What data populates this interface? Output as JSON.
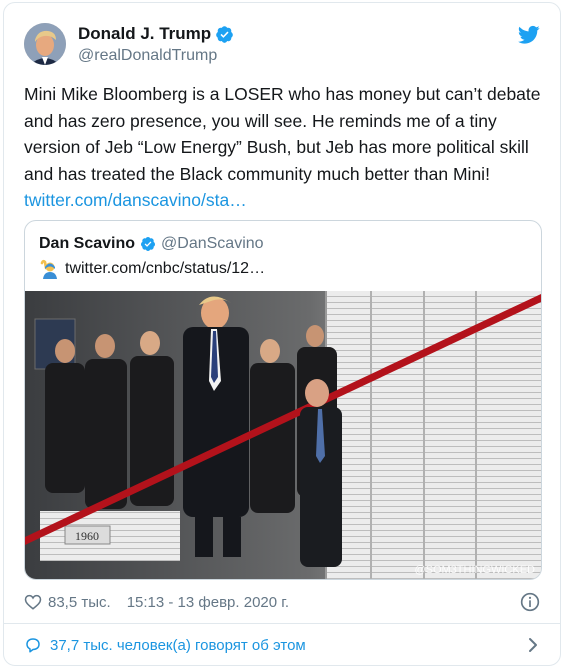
{
  "author": {
    "display_name": "Donald J. Trump",
    "handle": "@realDonaldTrump",
    "verified": true
  },
  "tweet": {
    "text": "Mini Mike Bloomberg is a LOSER who has money but can’t debate and has zero presence, you will see. He reminds me of a tiny version of Jeb “Low Energy” Bush, but Jeb has more political skill and has treated the Black community much better than Mini!",
    "link": "twitter.com/danscavino/sta…"
  },
  "quoted_tweet": {
    "display_name": "Dan Scavino",
    "handle": "@DanScavino",
    "verified": true,
    "emoji_icon": "person-raising-hand-emoji",
    "text": "twitter.com/cnbc/status/12…",
    "media": {
      "watermark": "@SOM3THINGWICKED",
      "stack_label": "1960"
    }
  },
  "meta": {
    "likes": "83,5 тыс.",
    "time": "15:13 - 13 февр. 2020 г."
  },
  "conversation": {
    "label": "37,7 тыс. человек(а) говорят об этом"
  },
  "colors": {
    "accent": "#1b95e0",
    "verified": "#1da1f2",
    "muted": "#657786",
    "border": "#e1e8ed",
    "ribbon": "#b3121b"
  }
}
